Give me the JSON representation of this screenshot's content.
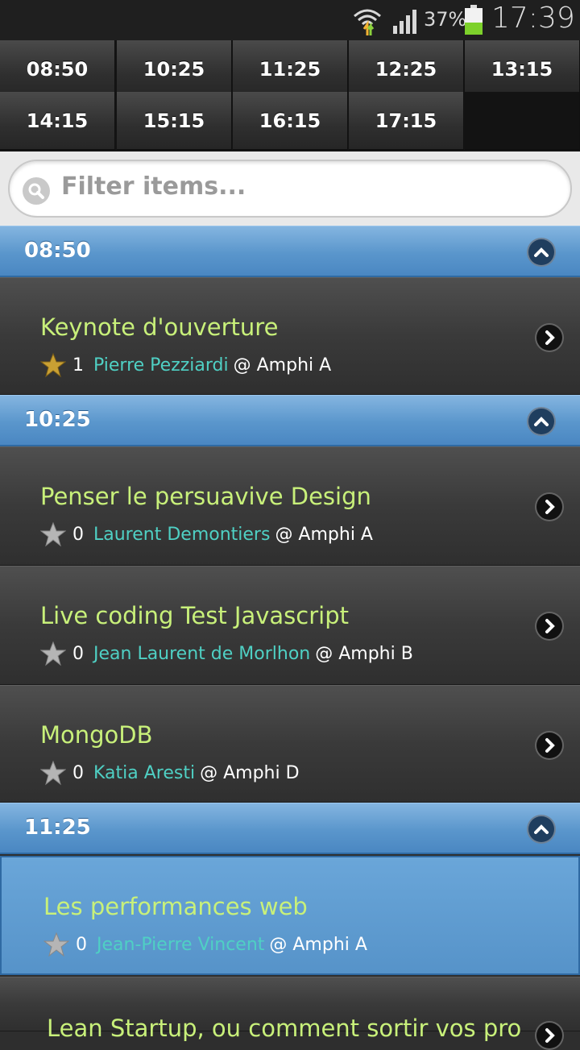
{
  "status": {
    "battery_pct": "37%",
    "clock": "17:39"
  },
  "time_slots": [
    "08:50",
    "10:25",
    "11:25",
    "12:25",
    "13:15",
    "14:15",
    "15:15",
    "16:15",
    "17:15"
  ],
  "filter": {
    "placeholder": "Filter items..."
  },
  "groups": [
    {
      "time": "08:50",
      "items": [
        {
          "title": "Keynote d'ouverture",
          "stars": "1",
          "speaker": "Pierre Pezziardi",
          "room": "@ Amphi A",
          "favorite": true
        }
      ]
    },
    {
      "time": "10:25",
      "items": [
        {
          "title": "Penser le persuavive Design",
          "stars": "0",
          "speaker": "Laurent Demontiers",
          "room": "@ Amphi A",
          "favorite": false
        },
        {
          "title": "Live coding Test Javascript",
          "stars": "0",
          "speaker": "Jean Laurent de Morlhon",
          "room": "@ Amphi B",
          "favorite": false
        },
        {
          "title": "MongoDB",
          "stars": "0",
          "speaker": "Katia Aresti",
          "room": "@ Amphi D",
          "favorite": false
        }
      ]
    },
    {
      "time": "11:25",
      "items": [
        {
          "title": "Les performances web",
          "stars": "0",
          "speaker": "Jean-Pierre Vincent",
          "room": "@ Amphi A",
          "favorite": false,
          "active": true
        },
        {
          "title": "Lean Startup, ou comment sortir vos pro",
          "stars": "",
          "speaker": "",
          "room": "",
          "favorite": false
        }
      ]
    }
  ],
  "colors": {
    "title": "#c8f07a",
    "speaker": "#4fd0c4",
    "divider": "#5a96cc",
    "star_gold": "#c9a033",
    "star_grey": "#b5b5b5"
  }
}
